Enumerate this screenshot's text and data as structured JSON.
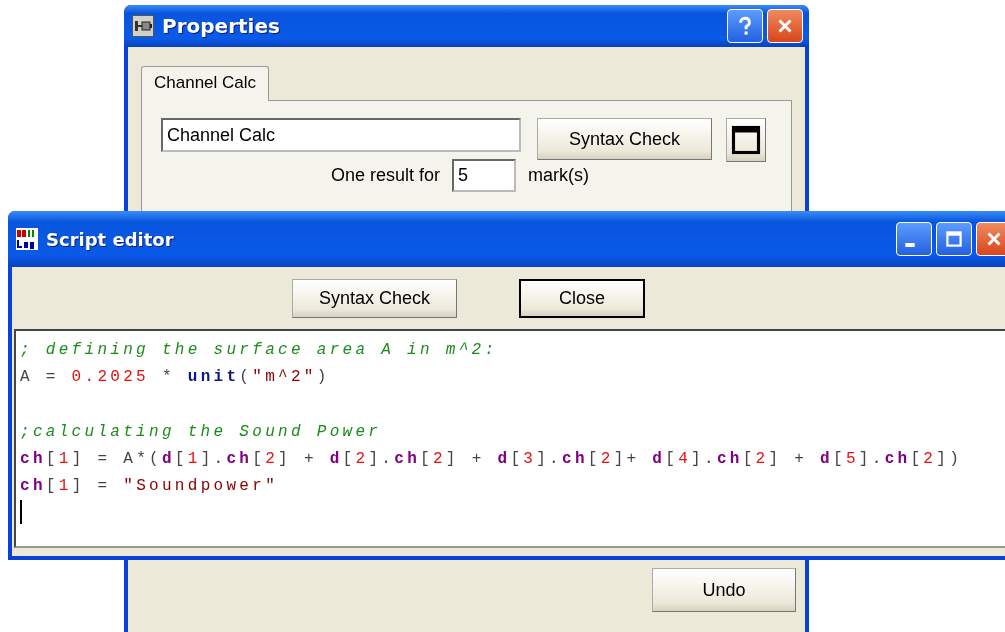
{
  "properties_window": {
    "title": "Properties",
    "tabs": [
      {
        "label": "Channel Calc",
        "selected": true
      }
    ],
    "name_field": {
      "value": "Channel Calc"
    },
    "syntax_check_button": "Syntax Check",
    "result_label": "One result for",
    "result_field": {
      "value": "5"
    },
    "result_unit": "mark(s)",
    "undo_button": "Undo"
  },
  "script_editor": {
    "title": "Script editor",
    "buttons": [
      {
        "label": "Syntax Check",
        "default": false
      },
      {
        "label": "Close",
        "default": true
      }
    ],
    "code_lines": [
      [
        {
          "kind": "c",
          "text": "; defining the surface area A in m^2:"
        }
      ],
      [
        {
          "kind": "t",
          "text": "A = "
        },
        {
          "kind": "n",
          "text": "0.2025"
        },
        {
          "kind": "t",
          "text": " * "
        },
        {
          "kind": "k",
          "text": "unit"
        },
        {
          "kind": "t",
          "text": "("
        },
        {
          "kind": "s",
          "text": "\"m^2\""
        },
        {
          "kind": "t",
          "text": ")"
        }
      ],
      {
        "gap_before": true,
        "tokens": [
          {
            "kind": "c",
            "text": ";calculating the Sound Power"
          }
        ]
      },
      [
        {
          "kind": "v",
          "text": "ch"
        },
        {
          "kind": "t",
          "text": "["
        },
        {
          "kind": "n",
          "text": "1"
        },
        {
          "kind": "t",
          "text": "] = A*("
        },
        {
          "kind": "v",
          "text": "d"
        },
        {
          "kind": "t",
          "text": "["
        },
        {
          "kind": "n",
          "text": "1"
        },
        {
          "kind": "t",
          "text": "]."
        },
        {
          "kind": "v",
          "text": "ch"
        },
        {
          "kind": "t",
          "text": "["
        },
        {
          "kind": "n",
          "text": "2"
        },
        {
          "kind": "t",
          "text": "] + "
        },
        {
          "kind": "v",
          "text": "d"
        },
        {
          "kind": "t",
          "text": "["
        },
        {
          "kind": "n",
          "text": "2"
        },
        {
          "kind": "t",
          "text": "]."
        },
        {
          "kind": "v",
          "text": "ch"
        },
        {
          "kind": "t",
          "text": "["
        },
        {
          "kind": "n",
          "text": "2"
        },
        {
          "kind": "t",
          "text": "] + "
        },
        {
          "kind": "v",
          "text": "d"
        },
        {
          "kind": "t",
          "text": "["
        },
        {
          "kind": "n",
          "text": "3"
        },
        {
          "kind": "t",
          "text": "]."
        },
        {
          "kind": "v",
          "text": "ch"
        },
        {
          "kind": "t",
          "text": "["
        },
        {
          "kind": "n",
          "text": "2"
        },
        {
          "kind": "t",
          "text": "]+ "
        },
        {
          "kind": "v",
          "text": "d"
        },
        {
          "kind": "t",
          "text": "["
        },
        {
          "kind": "n",
          "text": "4"
        },
        {
          "kind": "t",
          "text": "]."
        },
        {
          "kind": "v",
          "text": "ch"
        },
        {
          "kind": "t",
          "text": "["
        },
        {
          "kind": "n",
          "text": "2"
        },
        {
          "kind": "t",
          "text": "] + "
        },
        {
          "kind": "v",
          "text": "d"
        },
        {
          "kind": "t",
          "text": "["
        },
        {
          "kind": "n",
          "text": "5"
        },
        {
          "kind": "t",
          "text": "]."
        },
        {
          "kind": "v",
          "text": "ch"
        },
        {
          "kind": "t",
          "text": "["
        },
        {
          "kind": "n",
          "text": "2"
        },
        {
          "kind": "t",
          "text": "])"
        }
      ],
      [
        {
          "kind": "v",
          "text": "ch"
        },
        {
          "kind": "t",
          "text": "["
        },
        {
          "kind": "n",
          "text": "1"
        },
        {
          "kind": "t",
          "text": "] = "
        },
        {
          "kind": "s",
          "text": "\"Soundpower\""
        }
      ]
    ]
  }
}
